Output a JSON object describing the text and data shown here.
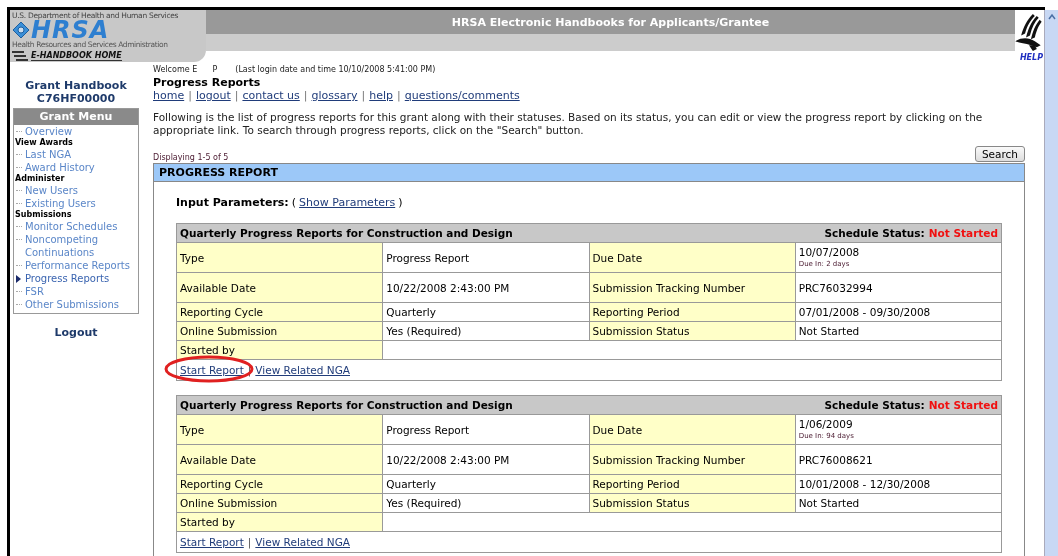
{
  "header": {
    "agency": "U.S. Department of Health and Human Services",
    "logo_text": "HRSA",
    "agency_full": "Health Resources and Services Administration",
    "home_link": "E-HANDBOOK HOME",
    "title": "HRSA Electronic Handbooks for Applicants/Grantee",
    "help": "HELP"
  },
  "sidebar": {
    "handbook_title": "Grant Handbook",
    "grant_number": "C76HF00000",
    "menu_title": "Grant Menu",
    "items": [
      {
        "kind": "link",
        "label": "Overview",
        "selected": false
      },
      {
        "kind": "heading",
        "label": "View Awards"
      },
      {
        "kind": "link",
        "label": "Last NGA",
        "selected": false
      },
      {
        "kind": "link",
        "label": "Award History",
        "selected": false
      },
      {
        "kind": "heading",
        "label": "Administer"
      },
      {
        "kind": "link",
        "label": "New Users",
        "selected": false
      },
      {
        "kind": "link",
        "label": "Existing Users",
        "selected": false
      },
      {
        "kind": "heading",
        "label": "Submissions"
      },
      {
        "kind": "link",
        "label": "Monitor Schedules",
        "selected": false
      },
      {
        "kind": "link",
        "label": "Noncompeting Continuations",
        "selected": false
      },
      {
        "kind": "link",
        "label": "Performance Reports",
        "selected": false
      },
      {
        "kind": "link",
        "label": "Progress Reports",
        "selected": true
      },
      {
        "kind": "link",
        "label": "FSR",
        "selected": false
      },
      {
        "kind": "link",
        "label": "Other Submissions",
        "selected": false
      }
    ],
    "logout": "Logout"
  },
  "welcome": {
    "greeting": "Welcome E      P",
    "last_login": "(Last login date and time 10/10/2008 5:41:00 PM)"
  },
  "page_title": "Progress Reports",
  "nav_links": [
    "home",
    "logout",
    "contact us",
    "glossary",
    "help",
    "questions/comments"
  ],
  "nav_separator": "|",
  "intro": "Following is the list of progress reports for this grant along with their statuses. Based on its status, you can edit or view the progress report by clicking on the appropriate link. To search through progress reports, click on the \"Search\" button.",
  "displaying": "Displaying 1-5 of 5",
  "search_button": "Search",
  "panel_title": "PROGRESS REPORT",
  "input_parameters": {
    "label": "Input Parameters:",
    "open": "(",
    "link": "Show Parameters",
    "close": ")"
  },
  "reports": [
    {
      "title": "Quarterly Progress Reports for Construction and Design",
      "status_label": "Schedule Status:",
      "status": "Not Started",
      "rows": [
        {
          "label": "Type",
          "value": "Progress Report",
          "label2": "Due Date",
          "value2": "10/07/2008",
          "note": "Due In: 2 days"
        },
        {
          "label": "Available Date",
          "value": "10/22/2008 2:43:00 PM",
          "label2": "Submission Tracking Number",
          "value2": "PRC76032994"
        },
        {
          "label": "Reporting Cycle",
          "value": "Quarterly",
          "label2": "Reporting Period",
          "value2": "07/01/2008 - 09/30/2008"
        },
        {
          "label": "Online Submission",
          "value": "Yes (Required)",
          "label2": "Submission Status",
          "value2": "Not Started"
        }
      ],
      "started_by": "Started by",
      "links": [
        "Start Report",
        "View Related NGA"
      ],
      "separator": "|",
      "circled": true
    },
    {
      "title": "Quarterly Progress Reports for Construction and Design",
      "status_label": "Schedule Status:",
      "status": "Not Started",
      "rows": [
        {
          "label": "Type",
          "value": "Progress Report",
          "label2": "Due Date",
          "value2": "1/06/2009",
          "note": "Due In: 94 days"
        },
        {
          "label": "Available Date",
          "value": "10/22/2008 2:43:00 PM",
          "label2": "Submission Tracking Number",
          "value2": "PRC76008621"
        },
        {
          "label": "Reporting Cycle",
          "value": "Quarterly",
          "label2": "Reporting Period",
          "value2": "10/01/2008 - 12/30/2008"
        },
        {
          "label": "Online Submission",
          "value": "Yes (Required)",
          "label2": "Submission Status",
          "value2": "Not Started"
        }
      ],
      "started_by": "Started by",
      "links": [
        "Start Report",
        "View Related NGA"
      ],
      "separator": "|",
      "circled": false
    }
  ]
}
